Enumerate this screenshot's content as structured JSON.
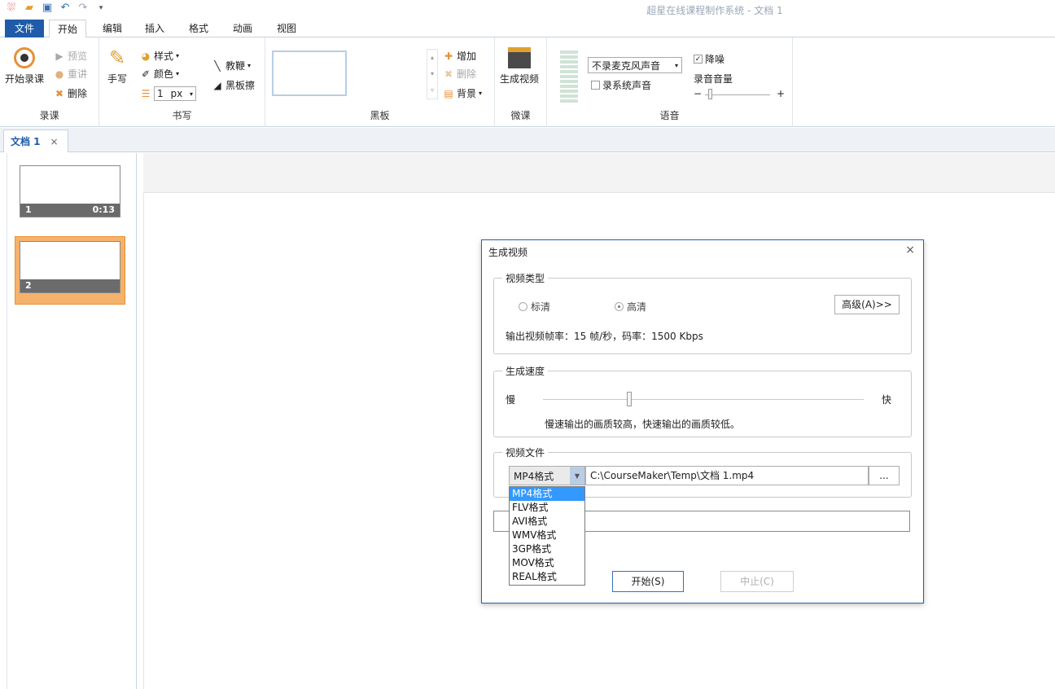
{
  "app": {
    "title": "超星在线课程制作系统 - 文档 1"
  },
  "menu": {
    "file": "文件",
    "tabs": [
      "开始",
      "编辑",
      "插入",
      "格式",
      "动画",
      "视图"
    ]
  },
  "ribbon": {
    "record": {
      "label": "录课",
      "start": "开始录课",
      "preview": "预览",
      "rerecord": "重讲",
      "delete": "删除"
    },
    "write": {
      "label": "书写",
      "handwrite": "手写",
      "style": "样式",
      "color": "颜色",
      "width_value": "1",
      "width_unit": "px",
      "pointer": "教鞭",
      "eraser": "黑板擦"
    },
    "board": {
      "label": "黑板",
      "add": "增加",
      "delete": "删除",
      "background": "背景"
    },
    "micro": {
      "label": "微课",
      "generate": "生成视频"
    },
    "audio": {
      "label": "语音",
      "mic_option": "不录麦克风声音",
      "system_sound": "录系统声音",
      "noise_reduce": "降噪",
      "volume_label": "录音音量",
      "minus": "−",
      "plus": "+"
    }
  },
  "doc_tab": {
    "label": "文档 1",
    "close": "×"
  },
  "slides": [
    {
      "num": "1",
      "duration": "0:13"
    },
    {
      "num": "2",
      "duration": ""
    }
  ],
  "dialog": {
    "title": "生成视频",
    "close": "×",
    "video_type": {
      "legend": "视频类型",
      "sd": "标清",
      "hd": "高清",
      "advanced": "高级(A)>>",
      "info": "输出视频帧率：15 帧/秒，码率：1500 Kbps"
    },
    "speed": {
      "legend": "生成速度",
      "slow": "慢",
      "fast": "快",
      "level": 0.27,
      "hint": "慢速输出的画质较高，快速输出的画质较低。"
    },
    "file": {
      "legend": "视频文件",
      "format": "MP4格式",
      "path": "C:\\CourseMaker\\Temp\\文档 1.mp4",
      "browse": "..."
    },
    "format_options": [
      "MP4格式",
      "FLV格式",
      "AVI格式",
      "WMV格式",
      "3GP格式",
      "MOV格式",
      "REAL格式"
    ],
    "start": "开始(S)",
    "stop": "中止(C)"
  }
}
